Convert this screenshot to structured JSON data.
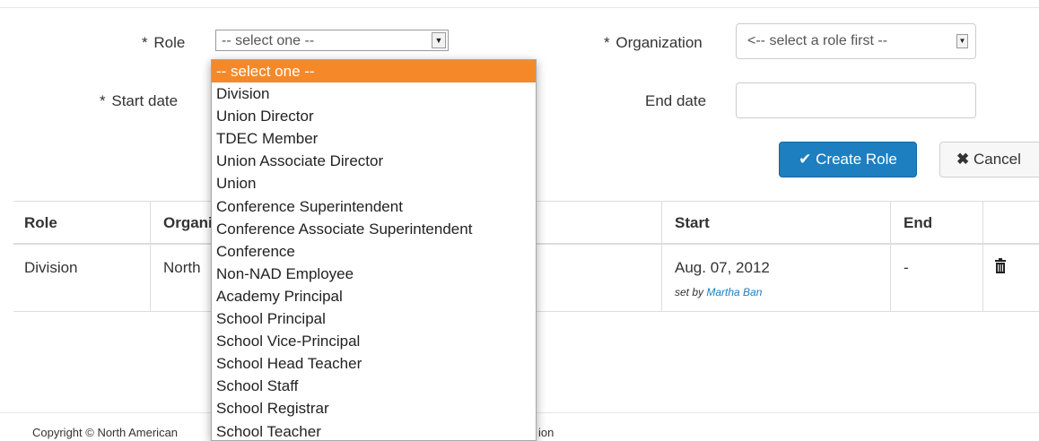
{
  "form": {
    "role_label": "Role",
    "required_mark": "*",
    "role_value": "-- select one --",
    "organization_label": "Organization",
    "organization_value": "<-- select a role first --",
    "start_date_label": "Start date",
    "end_date_label": "End date",
    "create_button": "Create Role",
    "cancel_button": "Cancel"
  },
  "table": {
    "headers": {
      "role": "Role",
      "organization": "Organization",
      "start": "Start",
      "end": "End"
    },
    "rows": [
      {
        "role": "Division",
        "organization": "North",
        "start": "Aug. 07, 2012",
        "set_by_prefix": "set by",
        "set_by_user": "Martha Ban",
        "end": "-"
      }
    ]
  },
  "dropdown": {
    "options": [
      "-- select one --",
      "Division",
      "Union Director",
      "TDEC Member",
      "Union Associate Director",
      "Union",
      "Conference Superintendent",
      "Conference Associate Superintendent",
      "Conference",
      "Non-NAD Employee",
      "Academy Principal",
      "School Principal",
      "School Vice-Principal",
      "School Head Teacher",
      "School Staff",
      "School Registrar",
      "School Teacher"
    ],
    "selected": 0
  },
  "footer": {
    "left": "Copyright © North American",
    "right": "ion"
  },
  "colors": {
    "primary": "#1d7fc0",
    "highlight": "#f5892a",
    "link": "#1d7fc0"
  },
  "icons": {
    "check": "check-icon",
    "cancel": "times-icon",
    "delete": "trash-icon"
  }
}
